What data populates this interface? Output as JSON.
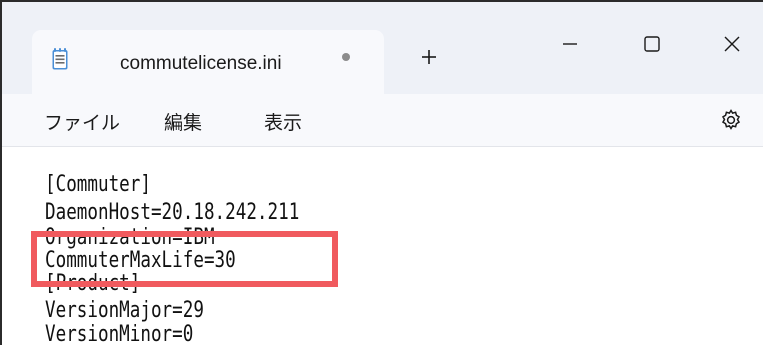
{
  "tab": {
    "title": "commutelicense.ini"
  },
  "menu": {
    "items": [
      "ファイル",
      "編集",
      "表示"
    ]
  },
  "editor": {
    "lines": [
      "[Commuter]",
      "DaemonHost=20.18.242.211",
      "Organization=IBM",
      "CommuterMaxLife=30",
      "[Product]",
      "VersionMajor=29",
      "VersionMinor=0"
    ]
  },
  "annotation": {
    "color": "#f05a5e"
  },
  "icons": {
    "file": "notepad-file-icon",
    "unsaved": "unsaved-dot-icon",
    "new_tab": "plus-icon",
    "minimize": "minimize-icon",
    "maximize": "maximize-icon",
    "close": "close-icon",
    "settings": "gear-icon"
  }
}
